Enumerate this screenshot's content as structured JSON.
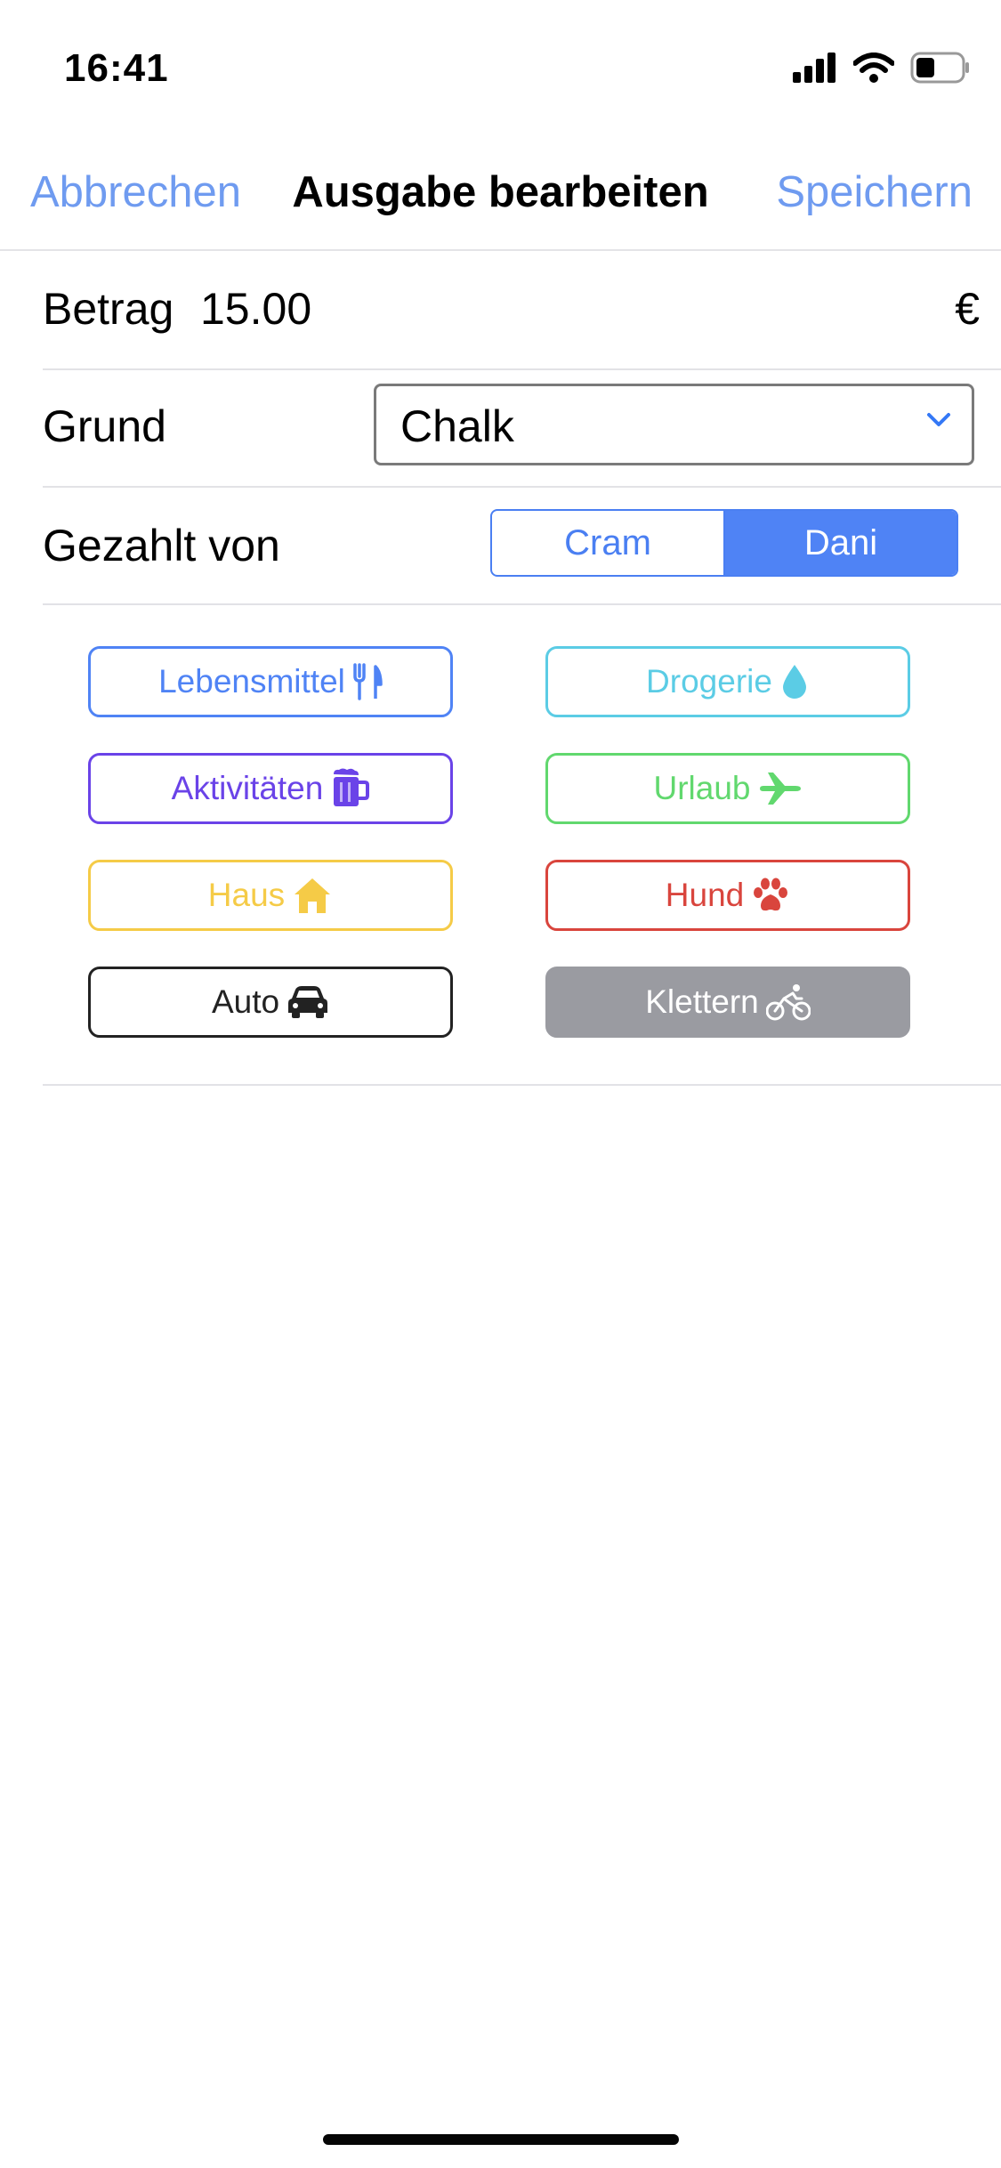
{
  "status_bar": {
    "time": "16:41",
    "icons": [
      "signal-icon",
      "wifi-icon",
      "battery-icon"
    ]
  },
  "nav": {
    "cancel": "Abbrechen",
    "title": "Ausgabe bearbeiten",
    "save": "Speichern"
  },
  "form": {
    "amount_label": "Betrag",
    "amount_value": "15.00",
    "currency": "€",
    "reason_label": "Grund",
    "reason_value": "Chalk",
    "paid_by_label": "Gezahlt von",
    "paid_by_options": [
      "Cram",
      "Dani"
    ],
    "paid_by_selected": "Dani"
  },
  "categories": [
    {
      "label": "Lebensmittel",
      "icon": "fork-knife-icon",
      "color": "#4f83f5",
      "selected": false
    },
    {
      "label": "Drogerie",
      "icon": "droplet-icon",
      "color": "#5bcce5",
      "selected": false
    },
    {
      "label": "Aktivitäten",
      "icon": "beer-mug-icon",
      "color": "#6a43e8",
      "selected": false
    },
    {
      "label": "Urlaub",
      "icon": "airplane-icon",
      "color": "#61d86e",
      "selected": false
    },
    {
      "label": "Haus",
      "icon": "house-icon",
      "color": "#f5cb47",
      "selected": false
    },
    {
      "label": "Hund",
      "icon": "paw-icon",
      "color": "#d9453d",
      "selected": false
    },
    {
      "label": "Auto",
      "icon": "car-icon",
      "color": "#222222",
      "selected": false
    },
    {
      "label": "Klettern",
      "icon": "bicycle-icon",
      "color": "#9a9ba1",
      "selected": true
    }
  ],
  "colors": {
    "accent": "#4f83f5",
    "nav_link": "#6f9bf0"
  }
}
